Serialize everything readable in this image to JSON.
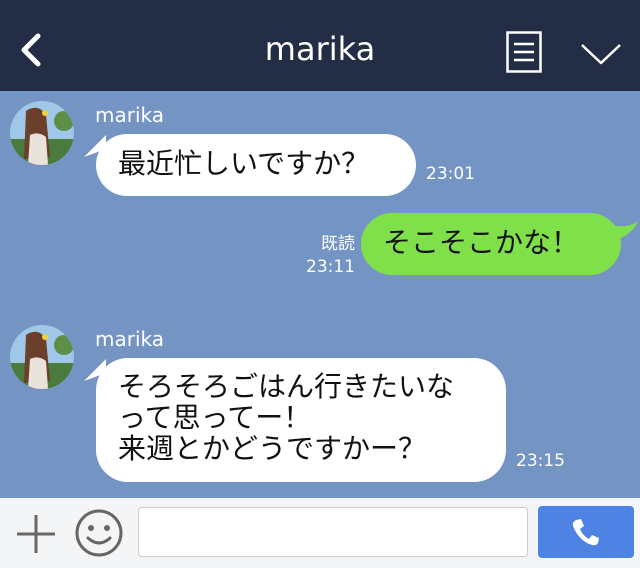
{
  "header": {
    "title": "marika",
    "back_icon": "chevron-left-icon",
    "menu_icon": "document-icon",
    "more_icon": "chevron-down-icon"
  },
  "messages": [
    {
      "sender": "marika",
      "text": [
        "最近忙しいですか？"
      ],
      "time": "23:01",
      "from_me": false
    },
    {
      "text": [
        "そこそこかな！"
      ],
      "time": "23:11",
      "read_label": "既読",
      "from_me": true
    },
    {
      "sender": "marika",
      "text": [
        "そろそろごはん行きたいな",
        "って思ってー！",
        "来週とかどうですかー？"
      ],
      "time": "23:15",
      "from_me": false
    }
  ],
  "composer": {
    "plus_icon": "plus-icon",
    "emoji_icon": "smiley-icon",
    "call_icon": "phone-icon"
  },
  "colors": {
    "header_bg": "#232d46",
    "chat_bg": "#7494c4",
    "my_bubble": "#80e04a",
    "their_bubble": "#ffffff",
    "call_button": "#4f83e3"
  }
}
